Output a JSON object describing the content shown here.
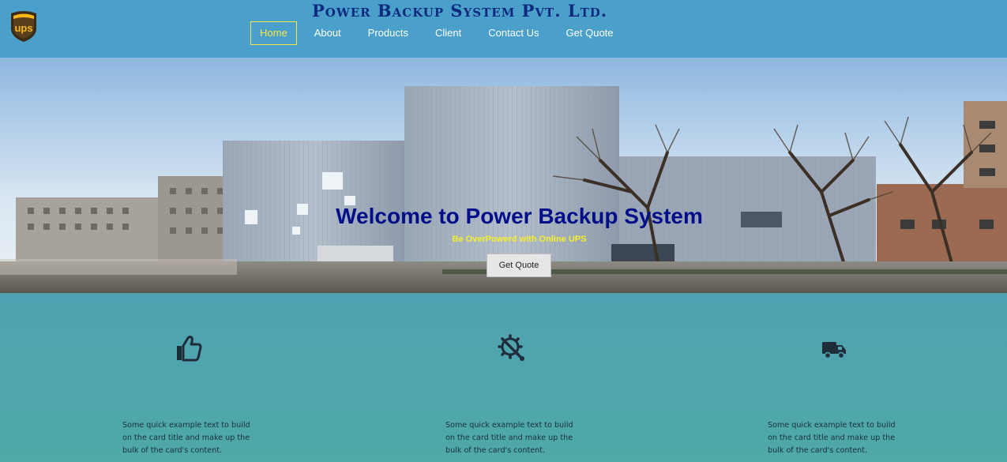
{
  "header": {
    "logo_text": "ups",
    "company_name": "Power Backup System Pvt. Ltd.",
    "nav": [
      {
        "label": "Home",
        "active": true
      },
      {
        "label": "About"
      },
      {
        "label": "Products"
      },
      {
        "label": "Client"
      },
      {
        "label": "Contact Us"
      },
      {
        "label": "Get Quote"
      }
    ]
  },
  "hero": {
    "title": "Welcome to Power Backup System",
    "subtitle": "Be OverPowerd with Online UPS",
    "button_label": "Get Quote"
  },
  "features": [
    {
      "icon": "thumbs-up-icon",
      "text": "Some quick example text to build on the card title and make up the bulk of the card's content."
    },
    {
      "icon": "gear-wrench-icon",
      "text": "Some quick example text to build on the card title and make up the bulk of the card's content."
    },
    {
      "icon": "delivery-truck-icon",
      "text": "Some quick example text to build on the card title and make up the bulk of the card's content."
    }
  ],
  "colors": {
    "header_bg": "#4aa0cb",
    "active_nav": "#f7e54a",
    "hero_title": "#000e8a",
    "hero_subtitle": "#f4f02a",
    "features_bg": "#50a1b2"
  }
}
